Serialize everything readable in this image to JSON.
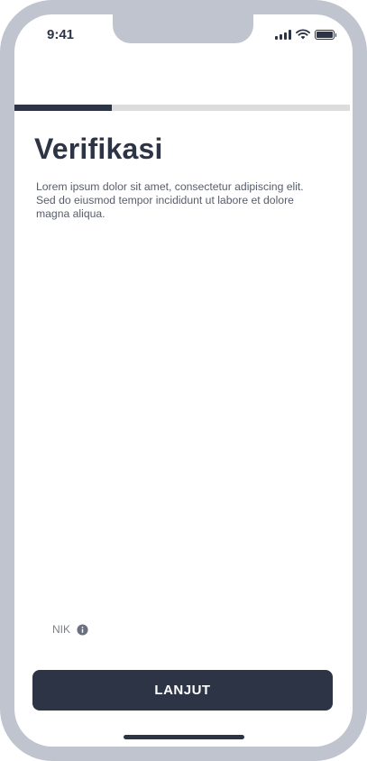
{
  "status_bar": {
    "time": "9:41",
    "icons": [
      "signal-icon",
      "wifi-icon",
      "battery-icon"
    ]
  },
  "progress": {
    "fraction": 0.29
  },
  "page": {
    "title": "Verifikasi",
    "description": "Lorem ipsum dolor sit amet, consectetur adipiscing elit. Sed do eiusmod tempor incididunt ut labore et dolore magna aliqua."
  },
  "form": {
    "nik_label": "NIK",
    "nik_icon": "info-icon"
  },
  "footer": {
    "next_label": "LANJUT"
  },
  "colors": {
    "primary": "#2d3446",
    "frame": "#bfc4ce",
    "track": "#dcdcdc"
  }
}
